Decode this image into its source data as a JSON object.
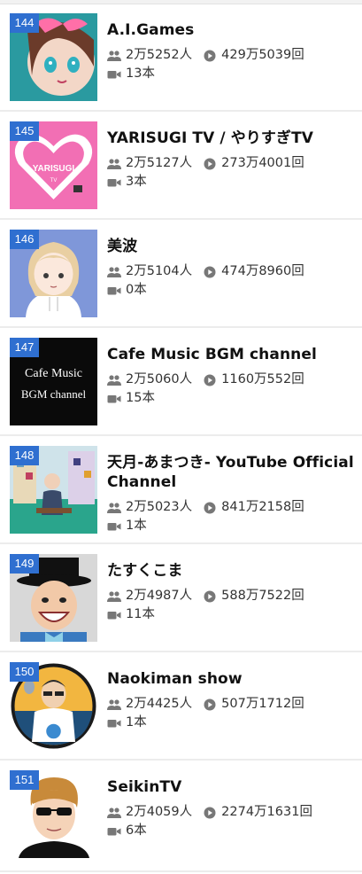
{
  "channels": [
    {
      "rank": "144",
      "name": "A.I.Games",
      "subscribers": "2万5252人",
      "views": "429万5039回",
      "videos": "13本",
      "thumb": "aigames"
    },
    {
      "rank": "145",
      "name": "YARISUGI TV / やりすぎTV",
      "subscribers": "2万5127人",
      "views": "273万4001回",
      "videos": "3本",
      "thumb": "yarisugi",
      "thumb_text": "YARISUGI",
      "thumb_subtext": "TV"
    },
    {
      "rank": "146",
      "name": "美波",
      "subscribers": "2万5104人",
      "views": "474万8960回",
      "videos": "0本",
      "thumb": "minami"
    },
    {
      "rank": "147",
      "name": "Cafe Music BGM channel",
      "subscribers": "2万5060人",
      "views": "1160万552回",
      "videos": "15本",
      "thumb": "cafe",
      "thumb_text": "Cafe Music",
      "thumb_subtext": "BGM channel"
    },
    {
      "rank": "148",
      "name": "天月-あまつき- YouTube Official Channel",
      "subscribers": "2万5023人",
      "views": "841万2158回",
      "videos": "1本",
      "thumb": "amatsuki"
    },
    {
      "rank": "149",
      "name": "たすくこま",
      "subscribers": "2万4987人",
      "views": "588万7522回",
      "videos": "11本",
      "thumb": "tasukukoma"
    },
    {
      "rank": "150",
      "name": "Naokiman show",
      "subscribers": "2万4425人",
      "views": "507万1712回",
      "videos": "1本",
      "thumb": "naokiman"
    },
    {
      "rank": "151",
      "name": "SeikinTV",
      "subscribers": "2万4059人",
      "views": "2274万1631回",
      "videos": "6本",
      "thumb": "seikin"
    }
  ],
  "colors": {
    "rank_badge": "#2f6fd0",
    "divider": "#ececec",
    "icon": "#777777"
  }
}
